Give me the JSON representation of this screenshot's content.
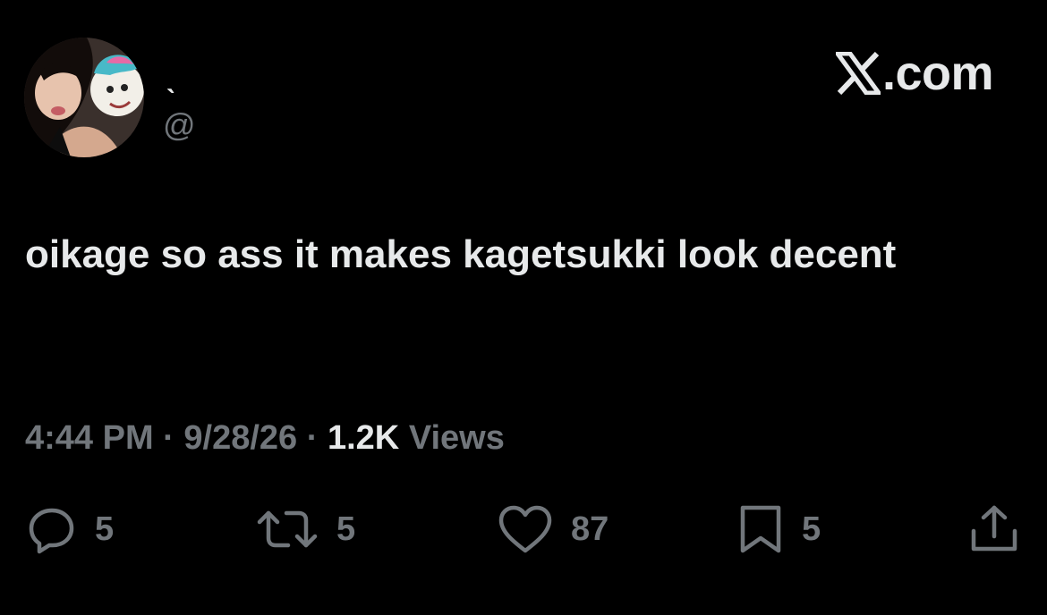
{
  "author": {
    "display_name": "ˎ",
    "handle": "@",
    "avatar_icon": "profile-photo"
  },
  "brand": {
    "logo_icon": "x-logo-icon",
    "suffix": ".com"
  },
  "tweet": {
    "text": "oikage so ass it makes kagetsukki look decent"
  },
  "meta": {
    "time": "4:44 PM",
    "sep1": " · ",
    "date": "9/28/26",
    "sep2": " · ",
    "views_count": "1.2K",
    "views_label": " Views"
  },
  "actions": {
    "reply": {
      "icon": "reply-icon",
      "count": "5"
    },
    "repost": {
      "icon": "repost-icon",
      "count": "5"
    },
    "like": {
      "icon": "heart-icon",
      "count": "87"
    },
    "bookmark": {
      "icon": "bookmark-icon",
      "count": "5"
    },
    "share": {
      "icon": "share-icon"
    }
  },
  "colors": {
    "background": "#000000",
    "primary_text": "#e7e9ea",
    "secondary_text": "#71767b"
  }
}
